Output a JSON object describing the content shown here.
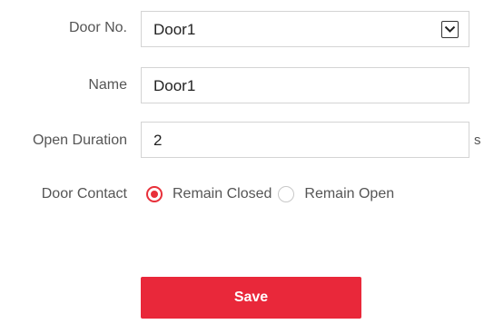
{
  "form": {
    "door_no": {
      "label": "Door No.",
      "value": "Door1",
      "icon": "chevron-down-icon"
    },
    "name": {
      "label": "Name",
      "value": "Door1"
    },
    "open_duration": {
      "label": "Open Duration",
      "value": "2",
      "unit": "s"
    },
    "door_contact": {
      "label": "Door Contact",
      "options": [
        {
          "label": "Remain Closed",
          "selected": true
        },
        {
          "label": "Remain Open",
          "selected": false
        }
      ]
    },
    "save_label": "Save"
  },
  "colors": {
    "accent": "#e8303a",
    "button": "#e9283a",
    "field_border": "#d4d4d4",
    "label_text": "#555555"
  }
}
